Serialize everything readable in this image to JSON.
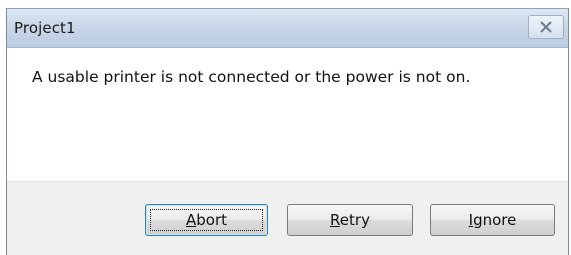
{
  "window": {
    "title": "Project1",
    "close_icon": "close-x-icon"
  },
  "message": {
    "text": "A usable printer is not connected or the power is not on."
  },
  "buttons": {
    "abort": {
      "label": "Abort",
      "mnemonic": "A",
      "rest": "bort",
      "default": true
    },
    "retry": {
      "label": "Retry",
      "mnemonic": "R",
      "rest": "etry"
    },
    "ignore": {
      "label": "Ignore",
      "mnemonic": "I",
      "rest": "gnore"
    }
  },
  "colors": {
    "titlebar": "#c9d7e8",
    "footer": "#f0f0f0",
    "default_button_border": "#3c7fb1"
  }
}
